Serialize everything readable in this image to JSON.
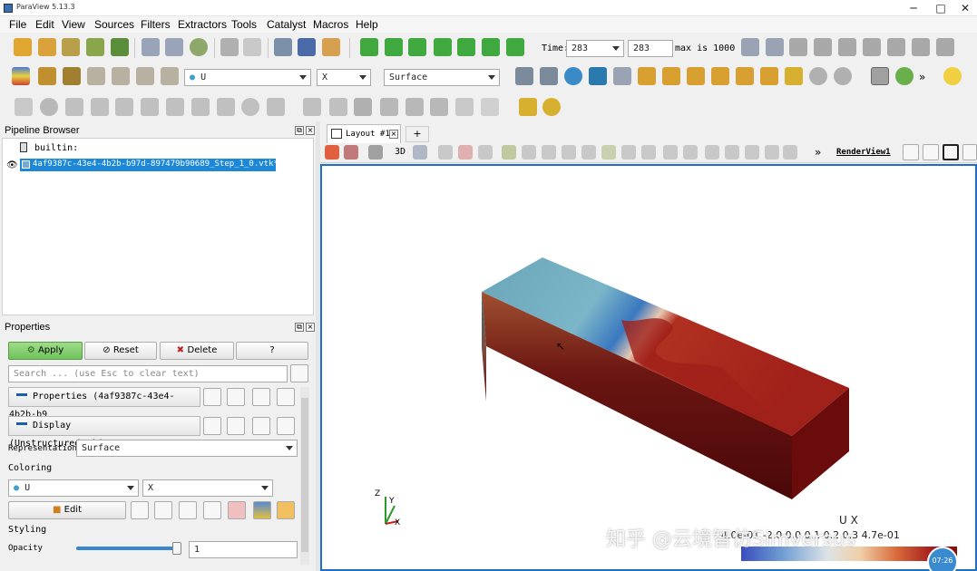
{
  "window": {
    "title": "ParaView 5.13.3",
    "minimize": "─",
    "maximize": "□",
    "close": "✕"
  },
  "menu": [
    "File",
    "Edit",
    "View",
    "Sources",
    "Filters",
    "Extractors",
    "Tools",
    "Catalyst",
    "Macros",
    "Help"
  ],
  "time": {
    "label": "Time:",
    "value": "283",
    "step": "283",
    "max_label": "max is 1000"
  },
  "toolbar2": {
    "array_combo": "U",
    "component_combo": "X",
    "representation_combo": "Surface"
  },
  "pipeline": {
    "title": "Pipeline Browser",
    "root": "builtin:",
    "item": "4af9387c-43e4-4b2b-b97d-897479b90689_Step_1_0.vtk*"
  },
  "properties": {
    "title": "Properties",
    "apply": "Apply",
    "reset": "Reset",
    "delete": "Delete",
    "help": "?",
    "search_placeholder": "Search ... (use Esc to clear text)",
    "section_properties": "Properties (4af9387c-43e4-4b2b-b9",
    "section_display": "Display (UnstructuredGridRepresen",
    "representation_label": "Representation",
    "representation_value": "Surface",
    "coloring_label": "Coloring",
    "coloring_array": "U",
    "coloring_component": "X",
    "edit": "Edit",
    "styling_label": "Styling",
    "opacity_label": "Opacity",
    "opacity_value": "1",
    "opacity_level": 1.0
  },
  "view": {
    "tab": "Layout #1",
    "add_tab": "+",
    "render_label": "RenderView1",
    "mode_3d": "3D"
  },
  "scalar_bar": {
    "title": "U X",
    "tick_labels": "4.0e-01  -2.0  0.0  0.1  0.2  0.3  4.7e-01",
    "colors": [
      "#3b4cc0",
      "#6a9ad0",
      "#dde3e7",
      "#f0d0a8",
      "#d96a3a",
      "#a51e1e",
      "#8b0a0a"
    ]
  },
  "axes": {
    "x": "X",
    "y": "Y",
    "z": "Z"
  },
  "watermark": "知乎 @云境智仿Simversus",
  "badge": "07:26"
}
